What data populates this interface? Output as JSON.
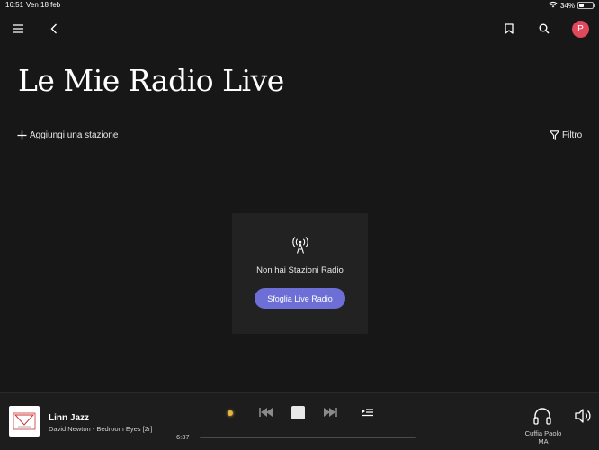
{
  "status_bar": {
    "time": "16:51",
    "date": "Ven 18 feb",
    "battery": "34%"
  },
  "header": {
    "avatar_initial": "P"
  },
  "page": {
    "title": "Le Mie Radio Live",
    "add_station_label": "Aggiungi una stazione",
    "filter_label": "Filtro"
  },
  "empty_state": {
    "message": "Non hai Stazioni Radio",
    "button_label": "Sfoglia Live Radio"
  },
  "player": {
    "station": "Linn Jazz",
    "track": "David Newton - Bedroom Eyes [2r]",
    "elapsed": "6:37",
    "output_device": "Cuffia Paolo MA"
  },
  "colors": {
    "background": "#171717",
    "accent_button": "#6d6fd6",
    "avatar": "#e0485b",
    "live_dot": "#e9b341"
  },
  "icons": [
    "wifi-icon",
    "battery-icon",
    "menu-icon",
    "back-icon",
    "bookmark-icon",
    "search-icon",
    "plus-icon",
    "filter-icon",
    "radio-tower-icon",
    "skip-previous-icon",
    "stop-icon",
    "skip-next-icon",
    "queue-icon",
    "headphones-icon",
    "volume-icon"
  ]
}
